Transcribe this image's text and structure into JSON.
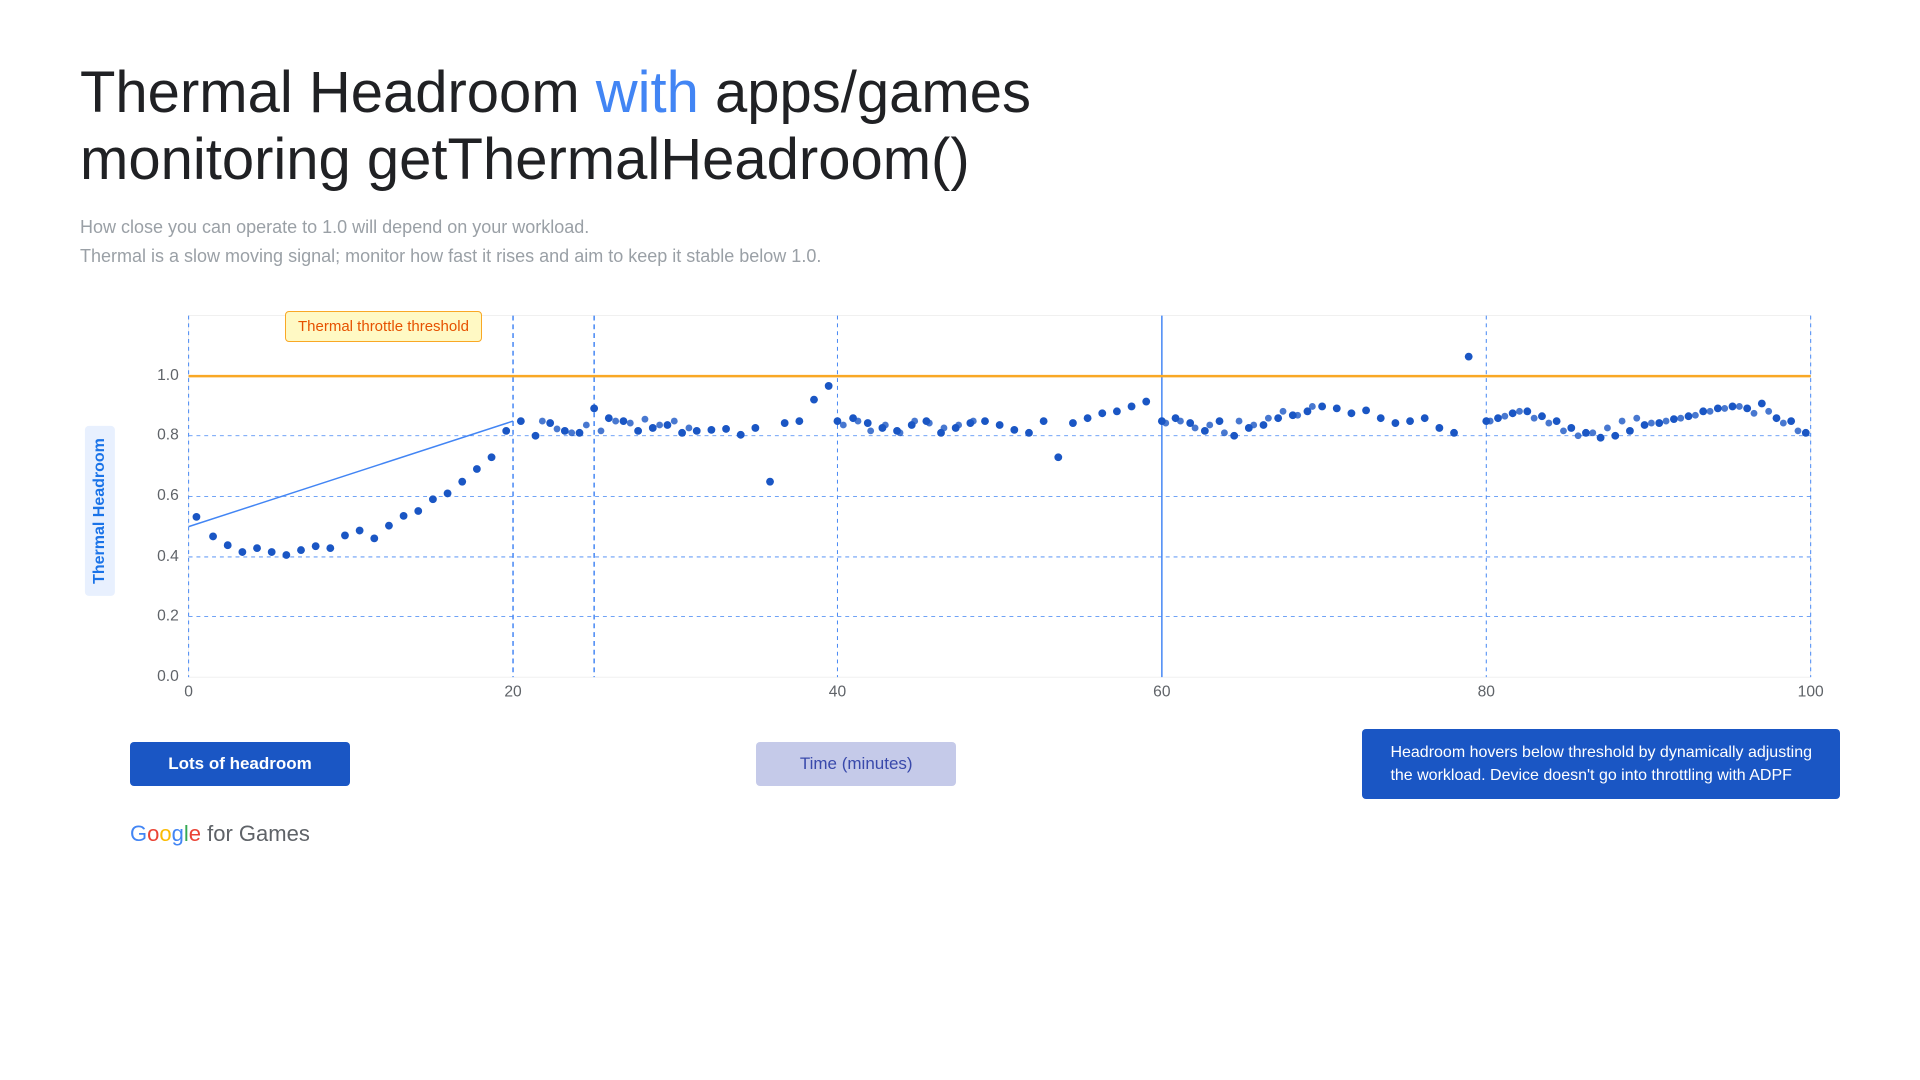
{
  "title": {
    "part1": "Thermal Headroom ",
    "highlight": "with",
    "part2": " apps/games",
    "line2": "monitoring getThermalHeadroom()"
  },
  "subtitle": {
    "line1": "How close you can operate to 1.0 will depend on your workload.",
    "line2": "Thermal is a slow moving signal; monitor how fast it rises and aim to keep it stable below 1.0."
  },
  "chart": {
    "yAxisLabel": "Thermal Headroom",
    "xAxisLabel": "Time (minutes)",
    "throttleLabel": "Thermal throttle threshold",
    "yTicks": [
      "0.0",
      "0.2",
      "0.4",
      "0.6",
      "0.8",
      "1.0"
    ],
    "xTicks": [
      "0",
      "20",
      "40",
      "60",
      "80",
      "100"
    ],
    "accentColor": "#f9a825",
    "lineColor": "#4285f4",
    "dotColor": "#1a56c4"
  },
  "labels": {
    "lots_of_headroom": "Lots of headroom",
    "time_minutes": "Time (minutes)",
    "description": "Headroom hovers below threshold by dynamically adjusting\nthe workload. Device doesn't go into throttling with ADPF"
  },
  "google": {
    "logo": "Google",
    "tagline": " for Games"
  }
}
